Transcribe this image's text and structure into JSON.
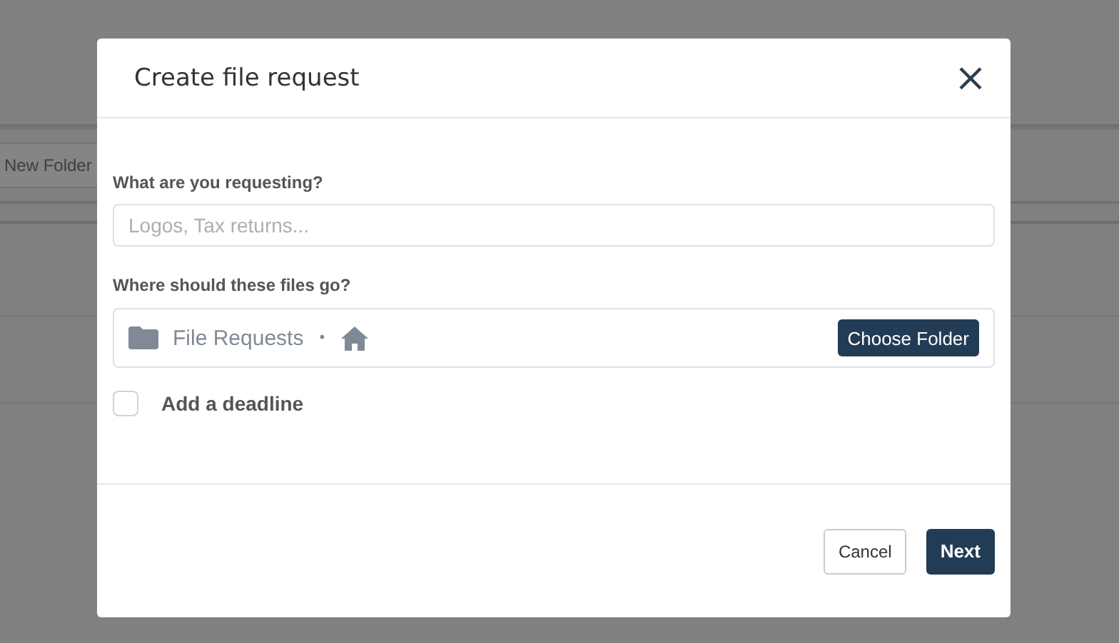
{
  "background": {
    "new_folder_button": "New Folder"
  },
  "dialog": {
    "title": "Create file request",
    "request_field": {
      "label": "What are you requesting?",
      "placeholder": "Logos, Tax returns..."
    },
    "destination": {
      "label": "Where should these files go?",
      "folder": "File Requests",
      "separator": "•",
      "button": "Choose Folder"
    },
    "deadline": {
      "label": "Add a deadline",
      "checked": false
    },
    "buttons": [
      {
        "label": "Cancel",
        "kind": "secondary"
      },
      {
        "label": "Next",
        "kind": "primary"
      }
    ]
  }
}
